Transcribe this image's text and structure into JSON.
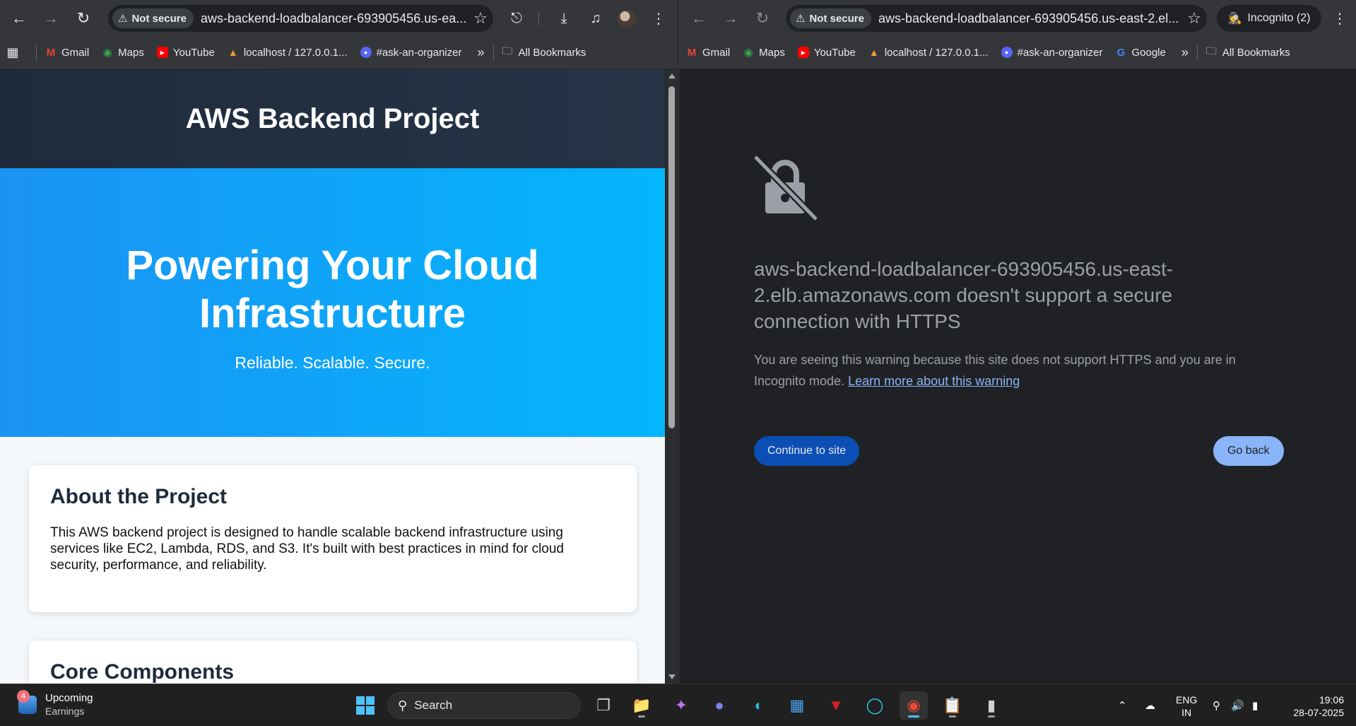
{
  "left_window": {
    "security_label": "Not secure",
    "url": "aws-backend-loadbalancer-693905456.us-ea...",
    "page": {
      "header_title": "AWS Backend Project",
      "hero_title": "Powering Your Cloud Infrastructure",
      "hero_subtitle": "Reliable. Scalable. Secure.",
      "about_title": "About the Project",
      "about_text": "This AWS backend project is designed to handle scalable backend infrastructure using services like EC2, Lambda, RDS, and S3. It's built with best practices in mind for cloud security, performance, and reliability.",
      "components_title": "Core Components"
    }
  },
  "right_window": {
    "security_label": "Not secure",
    "url": "aws-backend-loadbalancer-693905456.us-east-2.el...",
    "incognito_label": "Incognito (2)",
    "warning": {
      "title": "aws-backend-loadbalancer-693905456.us-east-2.elb.amazonaws.com doesn't support a secure connection with HTTPS",
      "text": "You are seeing this warning because this site does not support HTTPS and you are in Incognito mode.",
      "link": "Learn more about this warning",
      "continue_label": "Continue to site",
      "back_label": "Go back"
    }
  },
  "bookmarks_left": [
    {
      "label": "Gmail",
      "icon": "gmail-icon"
    },
    {
      "label": "Maps",
      "icon": "maps-icon"
    },
    {
      "label": "YouTube",
      "icon": "youtube-icon"
    },
    {
      "label": "localhost / 127.0.0.1...",
      "icon": "phpmyadmin-icon"
    },
    {
      "label": "#ask-an-organizer",
      "icon": "discord-icon"
    }
  ],
  "bookmarks_right": [
    {
      "label": "Gmail",
      "icon": "gmail-icon"
    },
    {
      "label": "Maps",
      "icon": "maps-icon"
    },
    {
      "label": "YouTube",
      "icon": "youtube-icon"
    },
    {
      "label": "localhost / 127.0.0.1...",
      "icon": "phpmyadmin-icon"
    },
    {
      "label": "#ask-an-organizer",
      "icon": "discord-icon"
    },
    {
      "label": "Google",
      "icon": "google-icon"
    }
  ],
  "all_bookmarks_label": "All Bookmarks",
  "taskbar": {
    "widget_badge": "4",
    "widget_line1": "Upcoming",
    "widget_line2": "Earnings",
    "search_label": "Search",
    "lang_line1": "ENG",
    "lang_line2": "IN",
    "time": "19:06",
    "date": "28-07-2025"
  },
  "colors": {
    "hero_start": "#1a93f5",
    "hero_end": "#04b6fb",
    "header_bg": "#1f2b3c",
    "continue_bg": "#0b4fb5",
    "back_bg": "#8ab4f8",
    "link": "#8ab4f8"
  }
}
